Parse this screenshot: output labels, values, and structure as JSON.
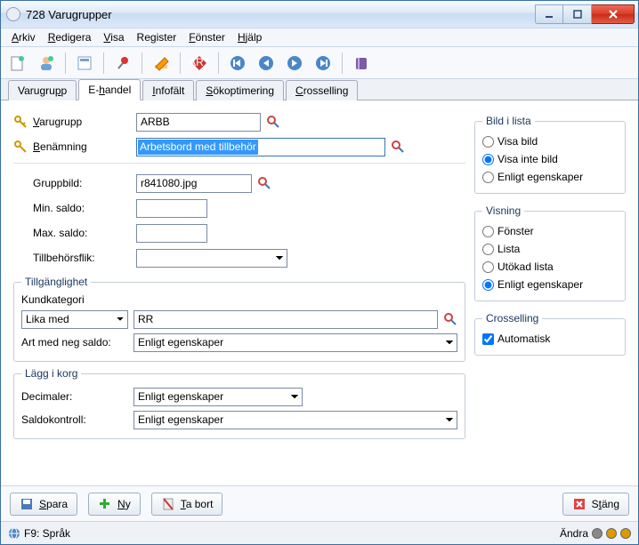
{
  "window": {
    "title": "728 Varugrupper"
  },
  "menu": {
    "arkiv": "Arkiv",
    "redigera": "Redigera",
    "visa": "Visa",
    "register": "Register",
    "fonster": "Fönster",
    "hjalp": "Hjälp"
  },
  "tabs": {
    "varugrupp": "Varugrupp",
    "ehandel": "E-handel",
    "infofalt": "Infofält",
    "sokopt": "Sökoptimering",
    "crosselling": "Crosselling"
  },
  "top": {
    "varugrupp_label": "Varugrupp",
    "varugrupp_value": "ARBB",
    "benamning_label": "Benämning",
    "benamning_value": "Arbetsbord med tillbehör"
  },
  "fields": {
    "gruppbild_label": "Gruppbild:",
    "gruppbild_value": "r841080.jpg",
    "minsaldo_label": "Min. saldo:",
    "minsaldo_value": "",
    "maxsaldo_label": "Max. saldo:",
    "maxsaldo_value": "",
    "tillbehorsflik_label": "Tillbehörsflik:",
    "tillbehorsflik_value": ""
  },
  "tillg": {
    "legend": "Tillgänglighet",
    "kundkat": "Kundkategori",
    "lika_med": "Lika med",
    "kund_value": "RR",
    "artneg_label": "Art med neg saldo:",
    "artneg_value": "Enligt egenskaper"
  },
  "lagg": {
    "legend": "Lägg i korg",
    "decimaler_label": "Decimaler:",
    "decimaler_value": "Enligt egenskaper",
    "saldok_label": "Saldokontroll:",
    "saldok_value": "Enligt egenskaper"
  },
  "bild": {
    "legend": "Bild i lista",
    "o1": "Visa bild",
    "o2": "Visa inte bild",
    "o3": "Enligt egenskaper"
  },
  "visning": {
    "legend": "Visning",
    "o1": "Fönster",
    "o2": "Lista",
    "o3": "Utökad lista",
    "o4": "Enligt egenskaper"
  },
  "cross": {
    "legend": "Crosselling",
    "auto": "Automatisk"
  },
  "buttons": {
    "spara": "Spara",
    "ny": "Ny",
    "tabort": "Ta bort",
    "stang": "Stäng"
  },
  "status": {
    "sprak": "F9: Språk",
    "andra": "Ändra"
  }
}
